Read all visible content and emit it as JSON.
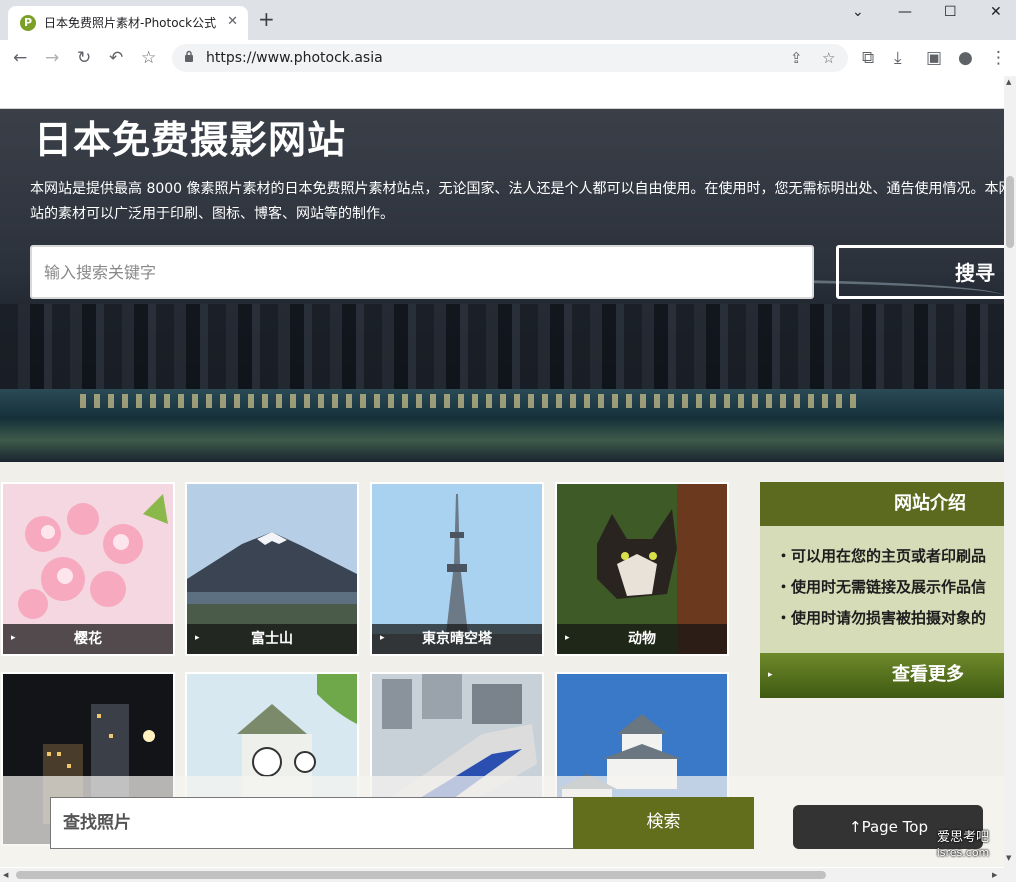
{
  "browser": {
    "tab_title": "日本免费照片素材-Photock公式",
    "favicon_letter": "P",
    "tab_close_icon": "✕",
    "new_tab_icon": "+",
    "url": "https://www.photock.asia",
    "window_controls": {
      "dropdown": "⌄",
      "minimize": "—",
      "maximize": "☐",
      "close": "✕"
    },
    "nav_icons": {
      "back": "←",
      "forward": "→",
      "reload": "↻",
      "undo": "↶",
      "bookmark": "☆"
    },
    "omnibox_icons": {
      "share": "⇪",
      "star": "☆"
    },
    "toolbar_icons": {
      "crop": "⧉",
      "download": "⤓",
      "sidepanel": "▣",
      "profile": "●",
      "menu": "⋮"
    }
  },
  "hero": {
    "title": "日本免费摄影网站",
    "description": "本网站是提供最高 8000 像素照片素材的日本免费照片素材站点，无论国家、法人还是个人都可以自由使用。在使用时，您无需标明出处、通告使用情况。本网站的素材可以广泛用于印刷、图标、博客、网站等的制作。",
    "search_placeholder": "输入搜索关键字",
    "search_button": "搜寻"
  },
  "categories": [
    {
      "name": "樱花",
      "icon": "cherry-blossom"
    },
    {
      "name": "富士山",
      "icon": "mount-fuji"
    },
    {
      "name": "東京晴空塔",
      "icon": "skytree"
    },
    {
      "name": "动物",
      "icon": "cat"
    },
    {
      "name": "",
      "icon": "night-city"
    },
    {
      "name": "",
      "icon": "clock-tower"
    },
    {
      "name": "",
      "icon": "bullet-train"
    },
    {
      "name": "",
      "icon": "castle"
    }
  ],
  "caption_arrow": "▸",
  "intro_panel": {
    "title": "网站介绍",
    "items": [
      "・可以用在您的主页或者印刷品",
      "・使用时无需链接及展示作品信",
      "・使用时请勿损害被拍摄对象的"
    ],
    "more_label": "查看更多"
  },
  "bottom_bar": {
    "search_placeholder": "查找照片",
    "search_button": "検索",
    "page_top": "↑Page Top"
  },
  "watermark": {
    "line1": "爱思考吧",
    "line2": "isres.com"
  },
  "colors": {
    "accent_olive": "#636e1c",
    "panel_head": "#5b6a1e",
    "panel_body": "#d7dcb8",
    "content_bg": "#f0efea"
  }
}
